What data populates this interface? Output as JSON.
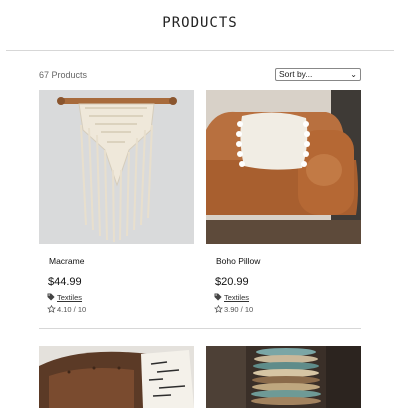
{
  "header": {
    "title": "PRODUCTS"
  },
  "toolbar": {
    "count": "67 Products",
    "sort_label": "Sort by..."
  },
  "products": [
    {
      "name": "Macrame",
      "price": "$44.99",
      "tag": "Textiles",
      "rating": "4.10 / 10"
    },
    {
      "name": "Boho Pillow",
      "price": "$20.99",
      "tag": "Textiles",
      "rating": "3.90 / 10"
    }
  ],
  "icons": {
    "tag": "tags-icon",
    "rating": "star-icon",
    "sort": "chevron-down-icon"
  }
}
